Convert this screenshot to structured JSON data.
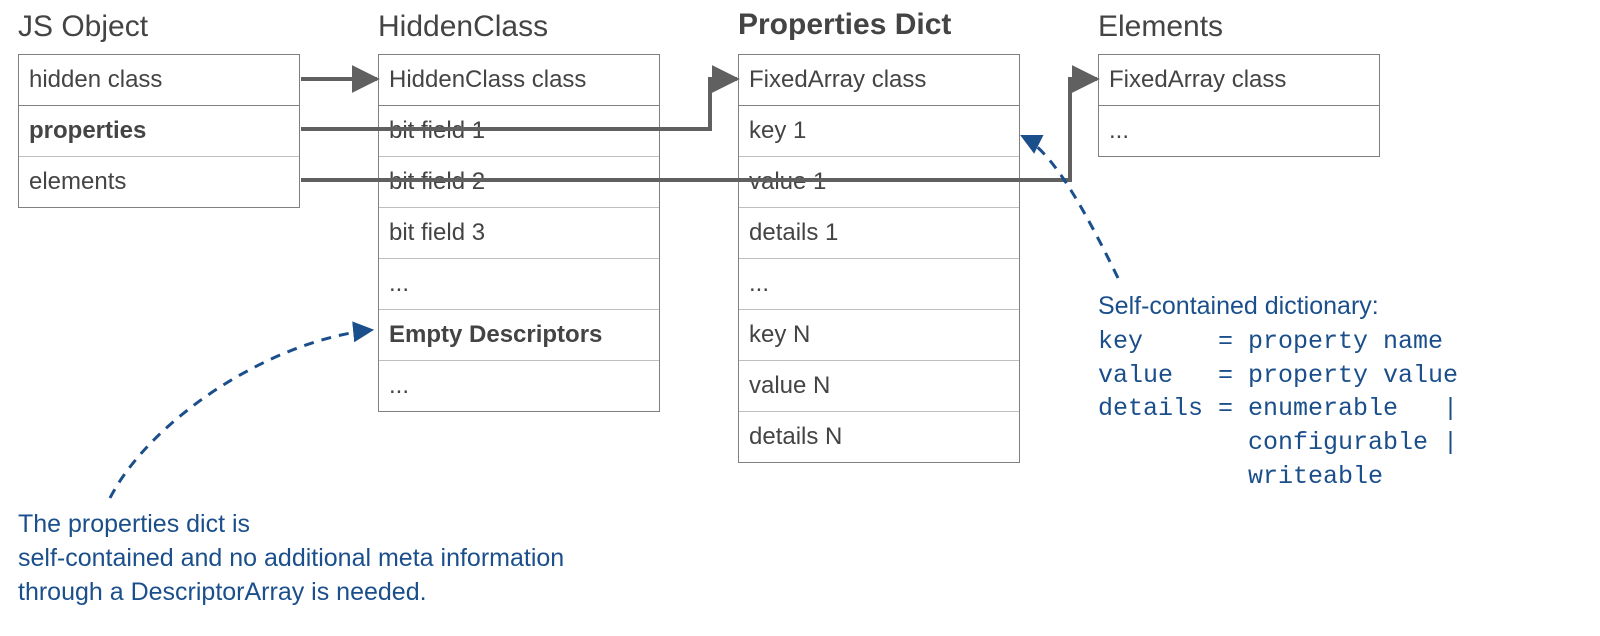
{
  "headings": {
    "jsobject": "JS Object",
    "hiddenclass": "HiddenClass",
    "propsdict": "Properties Dict",
    "elements": "Elements"
  },
  "jsobject": {
    "c0": "hidden class",
    "c1": "properties",
    "c2": "elements"
  },
  "hiddenclass": {
    "c0": "HiddenClass class",
    "c1": "bit field 1",
    "c2": "bit field 2",
    "c3": "bit field 3",
    "c4": "...",
    "c5": "Empty Descriptors",
    "c6": "..."
  },
  "propsdict": {
    "c0": "FixedArray class",
    "c1": "key 1",
    "c2": "value 1",
    "c3": "details 1",
    "c4": "...",
    "c5": "key N",
    "c6": "value N",
    "c7": "details N"
  },
  "elements": {
    "c0": "FixedArray class",
    "c1": "..."
  },
  "annotation_left": {
    "l1": "The properties dict is",
    "l2": "self-contained and no additional meta information",
    "l3": "through a DescriptorArray is needed."
  },
  "annotation_right": {
    "title": "Self-contained dictionary:",
    "body": "key     = property name\nvalue   = property value\ndetails = enumerable   |\n          configurable |\n          writeable"
  },
  "colors": {
    "border": "#808080",
    "inner_border": "#bfbfbf",
    "text": "#444444",
    "annotation": "#1b4f8b",
    "arrow": "#606060"
  }
}
